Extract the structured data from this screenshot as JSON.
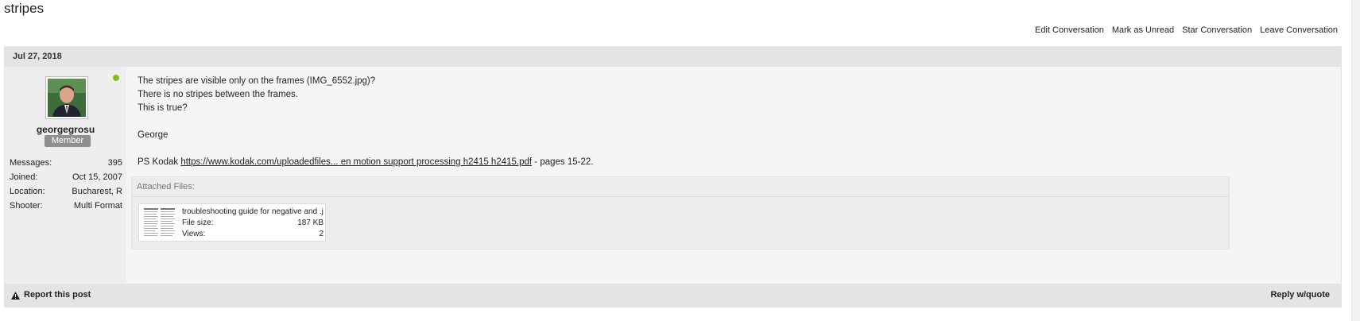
{
  "page": {
    "title": "stripes"
  },
  "conversation_actions": {
    "edit": "Edit Conversation",
    "mark_unread": "Mark as Unread",
    "star": "Star Conversation",
    "leave": "Leave Conversation"
  },
  "post": {
    "date": "Jul 27, 2018",
    "user": {
      "name": "georgegrosu",
      "title": "Member",
      "online": true,
      "stats": [
        {
          "label": "Messages:",
          "value": "395"
        },
        {
          "label": "Joined:",
          "value": "Oct 15, 2007"
        },
        {
          "label": "Location:",
          "value": "Bucharest, R"
        },
        {
          "label": "Shooter:",
          "value": "Multi Format"
        }
      ]
    },
    "message": {
      "line1": "The stripes are visible only on the frames (IMG_6552.jpg)?",
      "line2": "There is no stripes between the frames.",
      "line3": "This is true?",
      "signature": "George",
      "ps_prefix": "PS Kodak ",
      "ps_link": "https://www.kodak.com/uploadedfiles... en motion support processing h2415 h2415.pdf",
      "ps_suffix": " - pages 15-22."
    },
    "attachments": {
      "header": "Attached Files:",
      "files": [
        {
          "name": "troubleshooting guide for negative and .j...",
          "size_label": "File size:",
          "size": "187 KB",
          "views_label": "Views:",
          "views": "2"
        }
      ]
    },
    "footer": {
      "report": "Report this post",
      "reply": "Reply w/quote"
    }
  },
  "colors": {
    "online": "#7fbf28",
    "badge": "#8f8f8f"
  },
  "icons": {
    "report": "warning-icon"
  }
}
